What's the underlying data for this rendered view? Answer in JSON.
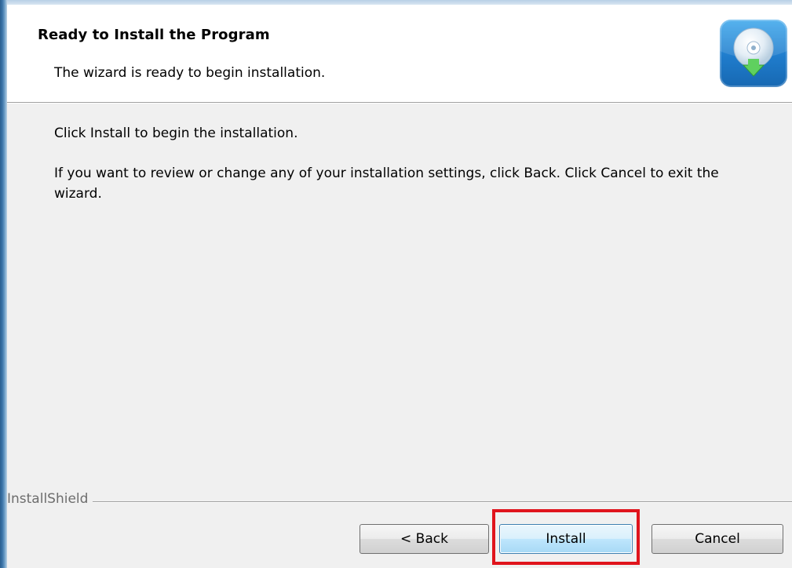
{
  "header": {
    "title": "Ready to Install the Program",
    "subtitle": "The wizard is ready to begin installation.",
    "logo_icon": "cd-install-icon"
  },
  "content": {
    "paragraph1": "Click Install to begin the installation.",
    "paragraph2": "If you want to review or change any of your installation settings, click Back. Click Cancel to exit the wizard."
  },
  "footer": {
    "brand": "InstallShield",
    "buttons": {
      "back": "< Back",
      "install": "Install",
      "cancel": "Cancel"
    }
  },
  "colors": {
    "highlight": "#e0141c",
    "logo_blue": "#1f7ccc",
    "default_button_border": "#3c7fb1"
  }
}
